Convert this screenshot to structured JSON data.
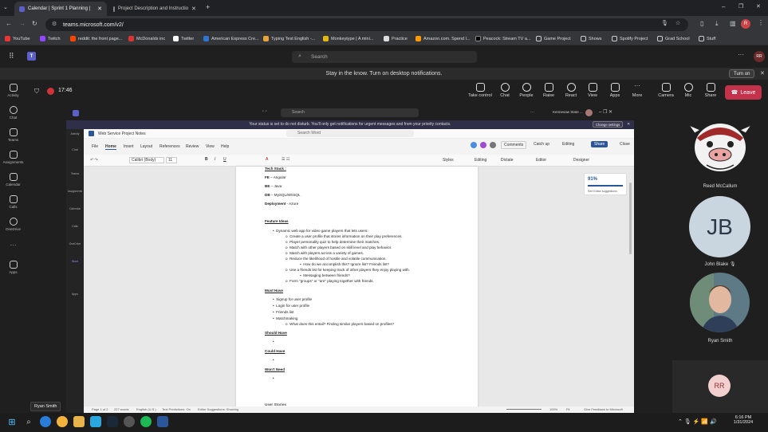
{
  "browser": {
    "tabs": [
      {
        "title": "Calendar | Sprint 1 Planning |",
        "active": true
      },
      {
        "title": "Project Description and Instructio",
        "active": false
      }
    ],
    "url": "teams.microsoft.com/v2/",
    "bookmarks": [
      "YouTube",
      "Twitch",
      "reddit: the front page...",
      "McDonalds inc",
      "Twitter",
      "American Express Cre...",
      "Typing Test English -...",
      "Monkeytype | A mini...",
      "Practice",
      "Amazon.com. Spend l...",
      "Peacock: Stream TV a...",
      "Game Project",
      "Shows",
      "Spotify Project",
      "Grad School",
      "Stuff"
    ]
  },
  "teams": {
    "search_placeholder": "Search",
    "notification": "Stay in the know. Turn on desktop notifications.",
    "turn_on": "Turn on",
    "call_time": "17:46",
    "rail": [
      "Activity",
      "Chat",
      "Teams",
      "Assignments",
      "Calendar",
      "Calls",
      "OneDrive",
      "Apps"
    ],
    "controls": [
      "Take control",
      "Chat",
      "People",
      "Raise",
      "React",
      "View",
      "Apps",
      "More",
      "Camera",
      "Mic",
      "Share"
    ],
    "leave": "Leave",
    "participants": [
      {
        "name": "Reed McCallum"
      },
      {
        "name": "John Blake",
        "initials": "JB"
      },
      {
        "name": "Ryan Smith"
      }
    ],
    "self_initials": "RR",
    "hover_label": "Ryan Smith"
  },
  "shared": {
    "search": "Search",
    "account": "Kennesaw State ...",
    "dnd": "Your status is set to do not disturb. You'll only get notifications for urgent messages and from your priority contacts.",
    "change_settings": "Change settings",
    "inner_rail": [
      "Activity",
      "Chat",
      "Teams",
      "Assignments",
      "Calendar",
      "Calls",
      "OneDrive",
      "Word",
      "Apps"
    ],
    "word_title": "Web Service Project Notes",
    "word_search": "Search Word",
    "menu": [
      "File",
      "Home",
      "Insert",
      "Layout",
      "References",
      "Review",
      "View",
      "Help"
    ],
    "comments": "Comments",
    "catch_up": "Catch up",
    "editing": "Editing",
    "share": "Share",
    "close": "Close",
    "font": "Calibri (Body)",
    "font_size": "11",
    "ribbon_right": [
      "Styles",
      "Editing",
      "Dictate",
      "Editor",
      "Designer"
    ],
    "editor_score": "91%",
    "editor_note": "See Editor suggestions",
    "doc": {
      "tech_stack": "Tech Stack :",
      "stack": [
        {
          "k": "FE",
          "v": " – Angular"
        },
        {
          "k": "BE",
          "v": " – Java"
        },
        {
          "k": "DB",
          "v": " – MySQL/MSSQL"
        },
        {
          "k": "Deployment",
          "v": " - Azure"
        }
      ],
      "feature_ideas": "Feature Ideas",
      "idea": "Dynamic web app for video game players that lets users:",
      "sub": [
        "Create a user profile that stores information on their play preferences.",
        "Player personality quiz to help determine their matches.",
        "Match with other players based on skill level and play behavior.",
        "Match with players across a variety of games.",
        "Reduce the likelihood of hostile and volatile communication."
      ],
      "subsub1": "How do we accomplish this? Ignore list? Friends list?",
      "sub2": "Use a friends list for keeping track of other players they enjoy playing with.",
      "subsub2": "Messaging between friends?",
      "sub3": "Form \"groups\" or \"are\" playing together with friends.",
      "must_have": "Must Have",
      "must": [
        "Signup for user profile",
        "Login for user profile",
        "Friends list",
        "Matchmaking"
      ],
      "must_sub": "What does this entail? Finding similar players based on profiles?",
      "should_have": "Should Have",
      "could_have": "Could Have",
      "wont_need": "Won't Need",
      "cut": "User Stories"
    },
    "status": {
      "page": "Page 1 of 2",
      "words": "227 words",
      "lang": "English (U.S.)",
      "predictions": "Text Predictions: On",
      "suggestions": "Editor Suggestions: Showing",
      "zoom": "100%",
      "fit": "Fit",
      "feedback": "Give Feedback to Microsoft"
    }
  },
  "taskbar": {
    "time": "6:16 PM",
    "date": "1/31/2024"
  }
}
